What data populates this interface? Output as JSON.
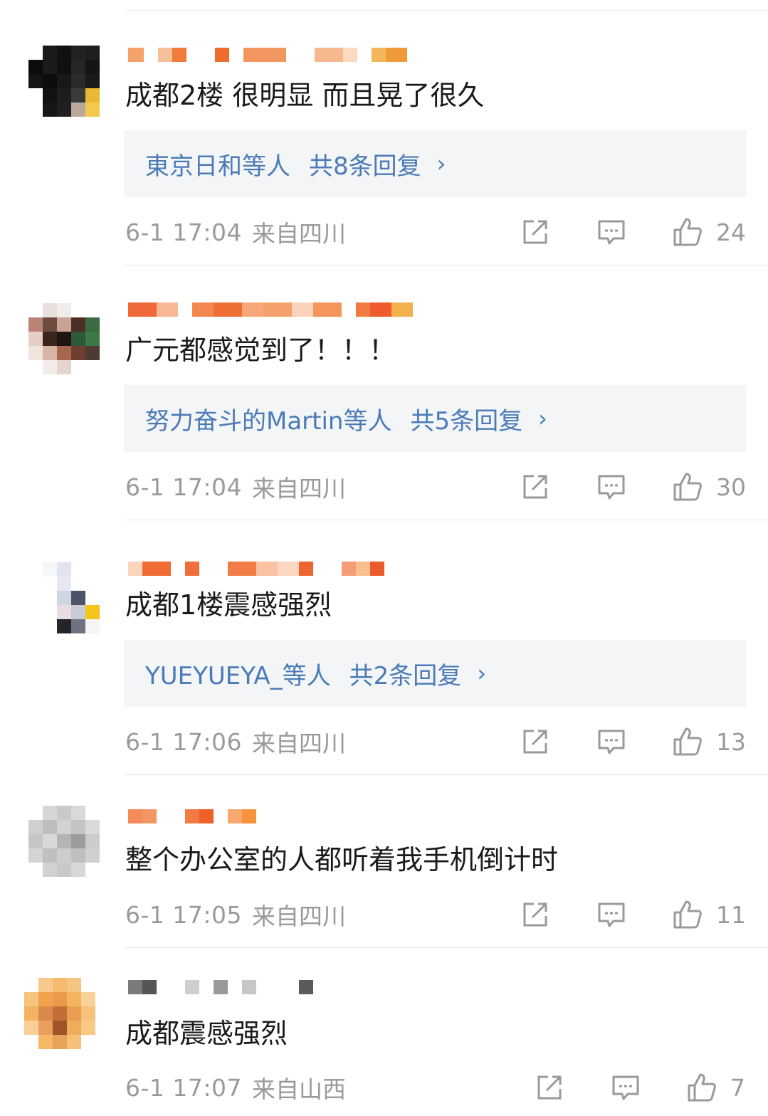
{
  "comments": [
    {
      "text": "成都2楼 很明显 而且晃了很久",
      "reply": {
        "users": "東京日和等人",
        "count": "共8条回复",
        "chevron": "›"
      },
      "time": "6-1 17:04",
      "source": "来自四川",
      "likes": "24"
    },
    {
      "text": "广元都感觉到了！！！",
      "reply": {
        "users": "努力奋斗的Martin等人",
        "count": "共5条回复",
        "chevron": "›"
      },
      "time": "6-1 17:04",
      "source": "来自四川",
      "likes": "30"
    },
    {
      "text": "成都1楼震感强烈",
      "reply": {
        "users": "YUEYUEYA_等人",
        "count": "共2条回复",
        "chevron": "›"
      },
      "time": "6-1 17:06",
      "source": "来自四川",
      "likes": "13"
    },
    {
      "text": "整个办公室的人都听着我手机倒计时",
      "time": "6-1 17:05",
      "source": "来自四川",
      "likes": "11"
    },
    {
      "text": "成都震感强烈",
      "time": "6-1 17:07",
      "source": "来自山西",
      "likes": "7"
    }
  ],
  "icons": {
    "repost": "share-icon",
    "comment": "comment-icon",
    "like": "thumbs-up-icon"
  },
  "colors": {
    "reply_link": "#4a7bb7",
    "meta_text": "#9a9a9a",
    "reply_bg": "#f4f5f7",
    "body_text": "#1a1a1a"
  }
}
